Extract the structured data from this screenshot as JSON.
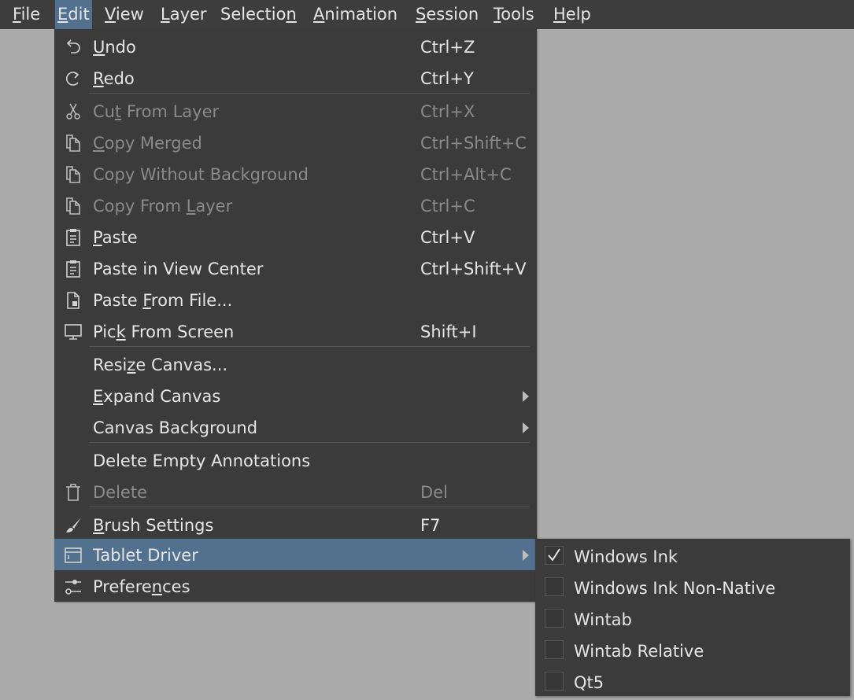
{
  "menubar": {
    "items": [
      {
        "pre": "",
        "u": "F",
        "post": "ile"
      },
      {
        "pre": "",
        "u": "E",
        "post": "dit"
      },
      {
        "pre": "",
        "u": "V",
        "post": "iew"
      },
      {
        "pre": "",
        "u": "L",
        "post": "ayer"
      },
      {
        "pre": "Selectio",
        "u": "n",
        "post": ""
      },
      {
        "pre": "",
        "u": "A",
        "post": "nimation"
      },
      {
        "pre": "",
        "u": "S",
        "post": "ession"
      },
      {
        "pre": "",
        "u": "T",
        "post": "ools"
      },
      {
        "pre": "",
        "u": "H",
        "post": "elp"
      }
    ]
  },
  "edit_menu": {
    "items": [
      {
        "pre": "",
        "u": "U",
        "post": "ndo",
        "shortcut": "Ctrl+Z",
        "icon": "undo-icon",
        "enabled": true
      },
      {
        "pre": "",
        "u": "R",
        "post": "edo",
        "shortcut": "Ctrl+Y",
        "icon": "redo-icon",
        "enabled": true
      },
      {
        "pre": "Cu",
        "u": "t",
        "post": " From Layer",
        "shortcut": "Ctrl+X",
        "icon": "scissors-icon",
        "enabled": false
      },
      {
        "pre": "",
        "u": "C",
        "post": "opy Merged",
        "shortcut": "Ctrl+Shift+C",
        "icon": "copy-icon",
        "enabled": false
      },
      {
        "pre": "Copy Without Background",
        "u": "",
        "post": "",
        "shortcut": "Ctrl+Alt+C",
        "icon": "copy-icon",
        "enabled": false
      },
      {
        "pre": "Copy From ",
        "u": "L",
        "post": "ayer",
        "shortcut": "Ctrl+C",
        "icon": "copy-icon",
        "enabled": false
      },
      {
        "pre": "",
        "u": "P",
        "post": "aste",
        "shortcut": "Ctrl+V",
        "icon": "paste-icon",
        "enabled": true
      },
      {
        "pre": "Paste in View Center",
        "u": "",
        "post": "",
        "shortcut": "Ctrl+Shift+V",
        "icon": "paste-icon",
        "enabled": true
      },
      {
        "pre": "Paste ",
        "u": "F",
        "post": "rom File...",
        "shortcut": "",
        "icon": "paste-file-icon",
        "enabled": true
      },
      {
        "pre": "Pic",
        "u": "k",
        "post": " From Screen",
        "shortcut": "Shift+I",
        "icon": "monitor-icon",
        "enabled": true
      },
      {
        "pre": "Resi",
        "u": "z",
        "post": "e Canvas...",
        "shortcut": "",
        "icon": "",
        "enabled": true
      },
      {
        "pre": "",
        "u": "E",
        "post": "xpand Canvas",
        "shortcut": "",
        "icon": "",
        "enabled": true,
        "submenu": true
      },
      {
        "pre": "Canvas Background",
        "u": "",
        "post": "",
        "shortcut": "",
        "icon": "",
        "enabled": true,
        "submenu": true
      },
      {
        "pre": "Delete Empty Annotations",
        "u": "",
        "post": "",
        "shortcut": "",
        "icon": "",
        "enabled": true
      },
      {
        "pre": "Delete",
        "u": "",
        "post": "",
        "shortcut": "Del",
        "icon": "trash-icon",
        "enabled": false
      },
      {
        "pre": "",
        "u": "B",
        "post": "rush Settings",
        "shortcut": "F7",
        "icon": "brush-icon",
        "enabled": true
      },
      {
        "pre": "Tablet Driver",
        "u": "",
        "post": "",
        "shortcut": "",
        "icon": "tablet-icon",
        "enabled": true,
        "submenu": true,
        "highlighted": true
      },
      {
        "pre": "Prefere",
        "u": "n",
        "post": "ces",
        "shortcut": "",
        "icon": "preferences-icon",
        "enabled": true
      }
    ]
  },
  "tablet_driver_menu": {
    "items": [
      {
        "label": "Windows Ink",
        "checked": true
      },
      {
        "label": "Windows Ink Non-Native",
        "checked": false
      },
      {
        "label": "Wintab",
        "checked": false
      },
      {
        "label": "Wintab Relative",
        "checked": false
      },
      {
        "label": "Qt5",
        "checked": false
      }
    ]
  },
  "colors": {
    "highlight": "#51718f",
    "menu_bg": "#3b3b3b",
    "menubar_bg": "#3d3d3d",
    "canvas_bg": "#ababab",
    "text": "#e6e6e6",
    "disabled_text": "#8a8a8a"
  }
}
